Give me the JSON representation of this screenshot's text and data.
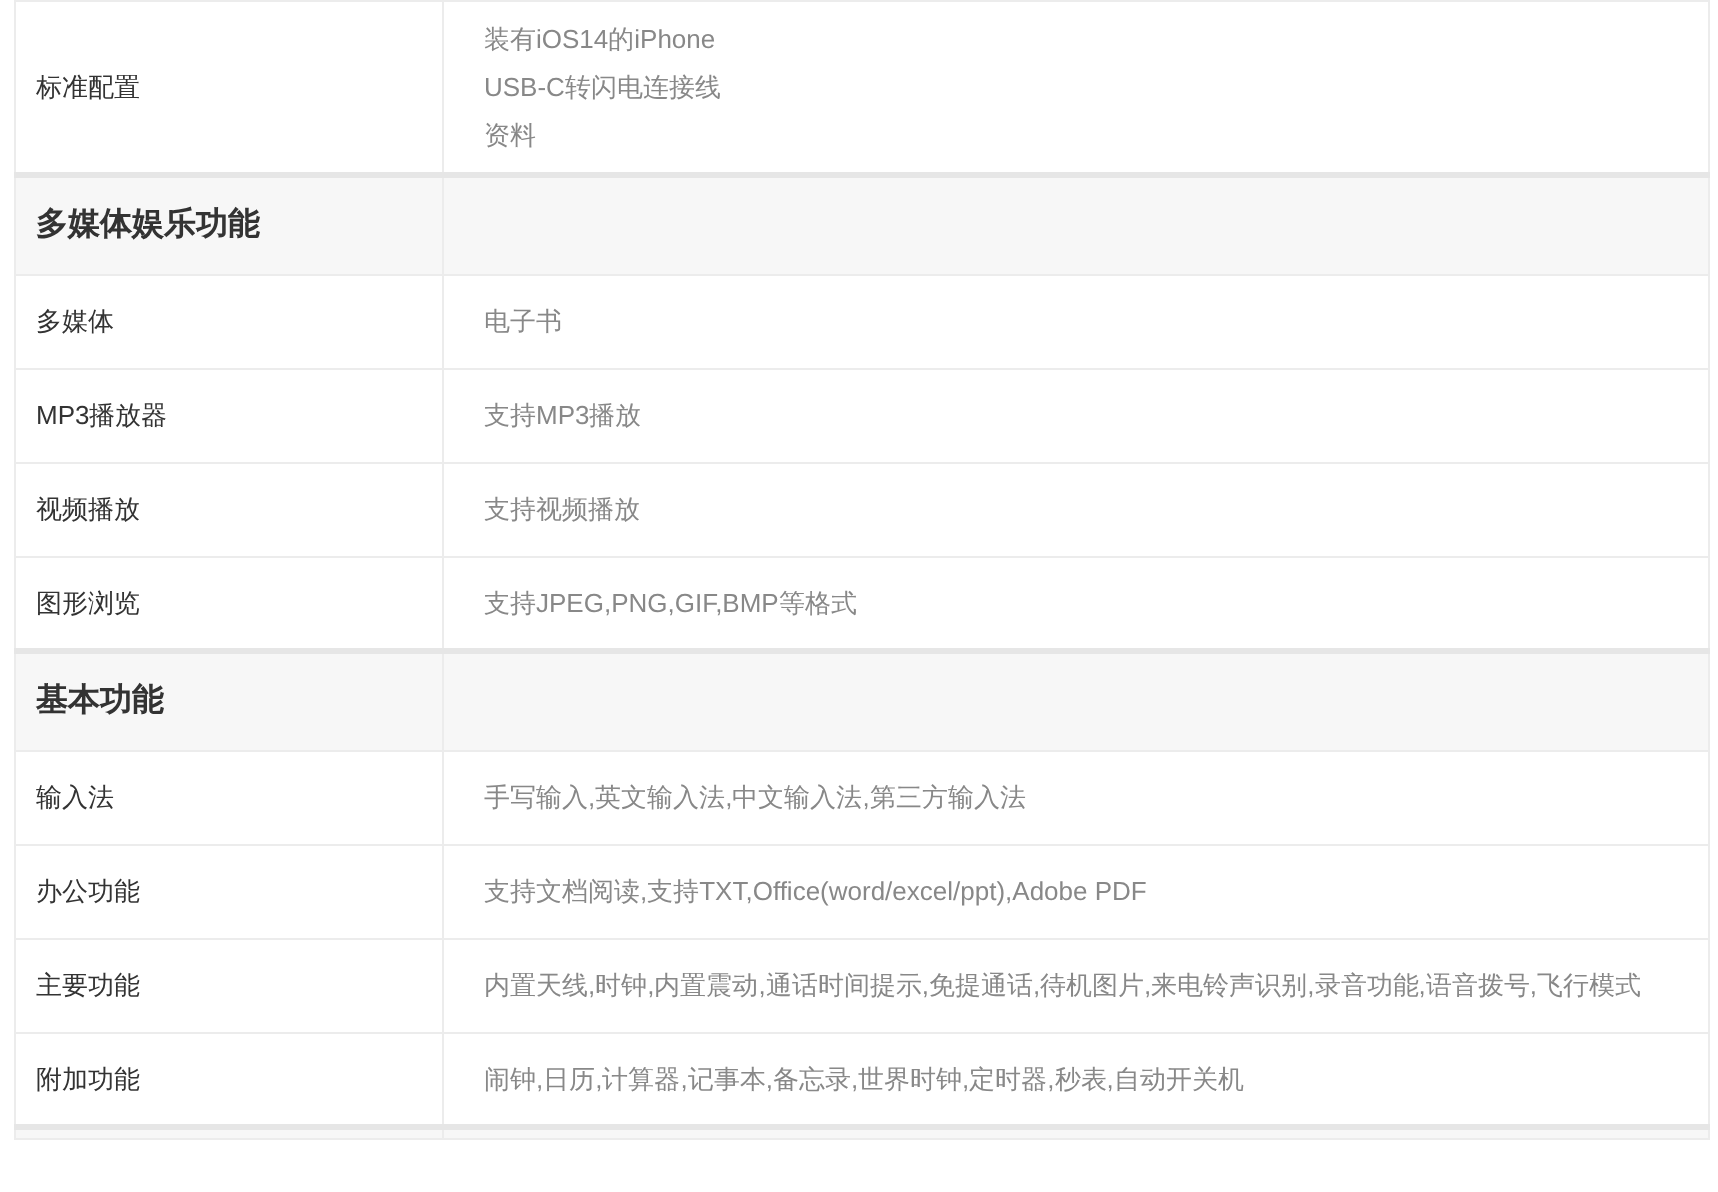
{
  "sections": [
    {
      "rows": [
        {
          "label": "标准配置",
          "values": [
            "装有iOS14的iPhone",
            "USB-C转闪电连接线",
            "资料"
          ]
        }
      ]
    },
    {
      "title": "多媒体娱乐功能",
      "rows": [
        {
          "label": "多媒体",
          "values": [
            "电子书"
          ]
        },
        {
          "label": "MP3播放器",
          "values": [
            "支持MP3播放"
          ]
        },
        {
          "label": "视频播放",
          "values": [
            "支持视频播放"
          ]
        },
        {
          "label": "图形浏览",
          "values": [
            "支持JPEG,PNG,GIF,BMP等格式"
          ]
        }
      ]
    },
    {
      "title": "基本功能",
      "rows": [
        {
          "label": "输入法",
          "values": [
            "手写输入,英文输入法,中文输入法,第三方输入法"
          ]
        },
        {
          "label": "办公功能",
          "values": [
            "支持文档阅读,支持TXT,Office(word/excel/ppt),Adobe PDF"
          ]
        },
        {
          "label": "主要功能",
          "values": [
            "内置天线,时钟,内置震动,通话时间提示,免提通话,待机图片,来电铃声识别,录音功能,语音拨号,飞行模式"
          ]
        },
        {
          "label": "附加功能",
          "values": [
            "闹钟,日历,计算器,记事本,备忘录,世界时钟,定时器,秒表,自动开关机"
          ]
        }
      ]
    }
  ]
}
